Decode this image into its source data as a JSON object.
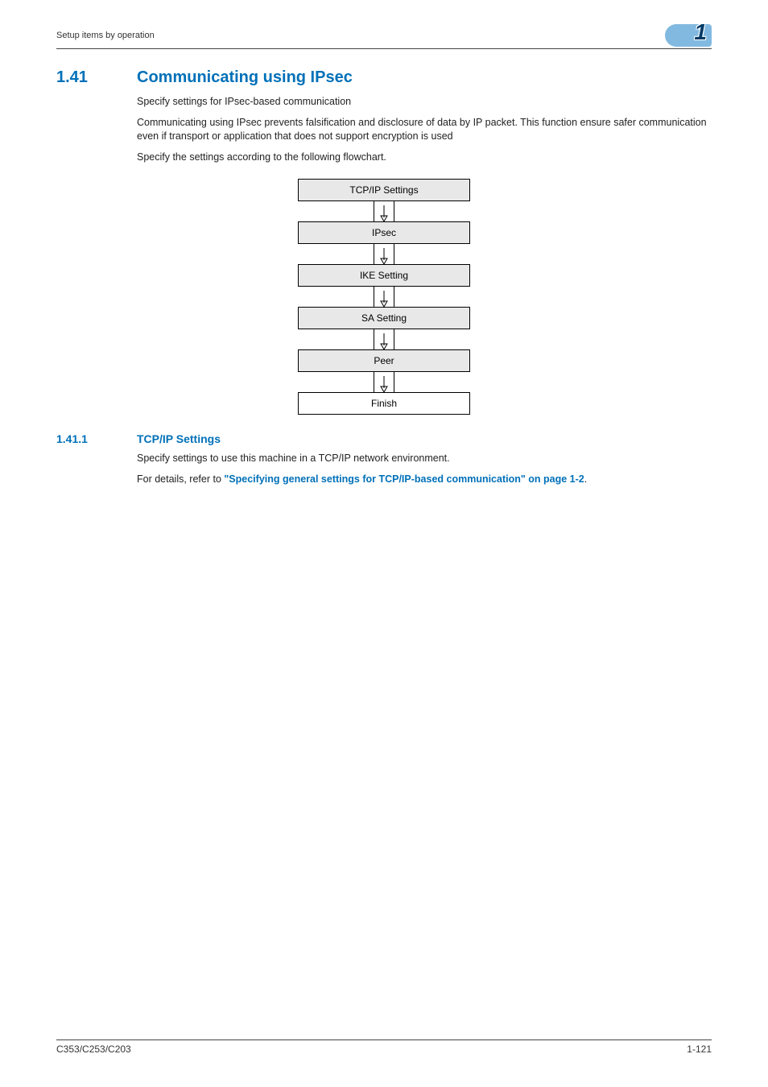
{
  "header": {
    "running_head": "Setup items by operation",
    "chapter_num": "1"
  },
  "section": {
    "num": "1.41",
    "title": "Communicating using IPsec",
    "p1": "Specify settings for IPsec-based communication",
    "p2": "Communicating using IPsec prevents falsification and disclosure of data by IP packet. This function ensure safer communication even if transport or application that does not support encryption is used",
    "p3": "Specify the settings according to the following flowchart."
  },
  "flowchart": {
    "steps": [
      "TCP/IP Settings",
      "IPsec",
      "IKE Setting",
      "SA Setting",
      "Peer",
      "Finish"
    ]
  },
  "subsection": {
    "num": "1.41.1",
    "title": "TCP/IP Settings",
    "p1": "Specify settings to use this machine in a TCP/IP network environment.",
    "p2_prefix": "For details, refer to ",
    "p2_link": "\"Specifying general settings for TCP/IP-based communication\" on page 1-2",
    "p2_suffix": "."
  },
  "footer": {
    "left": "C353/C253/C203",
    "right": "1-121"
  }
}
